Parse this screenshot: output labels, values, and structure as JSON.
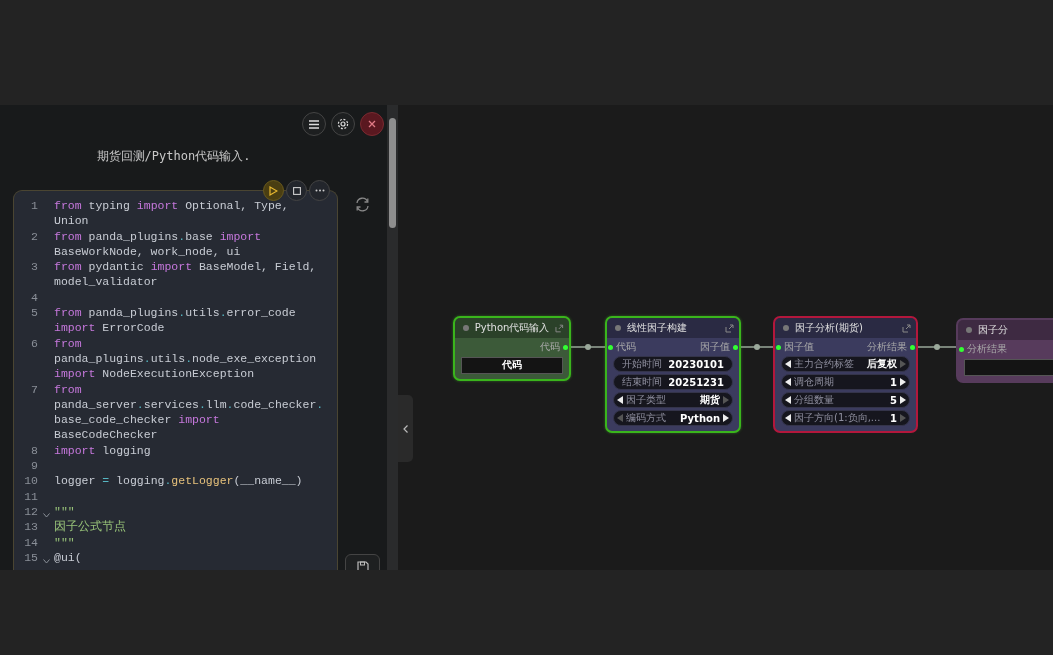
{
  "panel": {
    "title": "期货回测/Python代码输入.",
    "code_lines": [
      {
        "number": "1",
        "fold": false,
        "tokens": [
          {
            "kind": "kw",
            "text": "from"
          },
          {
            "kind": "plain",
            "text": " typing "
          },
          {
            "kind": "kw",
            "text": "import"
          },
          {
            "kind": "plain",
            "text": " Optional, Type,"
          },
          {
            "kind": "wrap"
          },
          {
            "kind": "plain",
            "text": "Union"
          }
        ]
      },
      {
        "number": "2",
        "fold": false,
        "tokens": [
          {
            "kind": "kw",
            "text": "from"
          },
          {
            "kind": "plain",
            "text": " panda_plugins"
          },
          {
            "kind": "op",
            "text": "."
          },
          {
            "kind": "plain",
            "text": "base "
          },
          {
            "kind": "kw",
            "text": "import"
          },
          {
            "kind": "wrap"
          },
          {
            "kind": "plain",
            "text": "BaseWorkNode, work_node, ui"
          }
        ]
      },
      {
        "number": "3",
        "fold": false,
        "tokens": [
          {
            "kind": "kw",
            "text": "from"
          },
          {
            "kind": "plain",
            "text": " pydantic "
          },
          {
            "kind": "kw",
            "text": "import"
          },
          {
            "kind": "plain",
            "text": " BaseModel, Field,"
          },
          {
            "kind": "wrap"
          },
          {
            "kind": "plain",
            "text": "model_validator"
          }
        ]
      },
      {
        "number": "4",
        "fold": false
      },
      {
        "number": "5",
        "fold": false,
        "tokens": [
          {
            "kind": "kw",
            "text": "from"
          },
          {
            "kind": "plain",
            "text": " panda_plugins"
          },
          {
            "kind": "op",
            "text": "."
          },
          {
            "kind": "plain",
            "text": "utils"
          },
          {
            "kind": "op",
            "text": "."
          },
          {
            "kind": "plain",
            "text": "error_code"
          },
          {
            "kind": "wrap"
          },
          {
            "kind": "kw",
            "text": "import"
          },
          {
            "kind": "plain",
            "text": " ErrorCode"
          }
        ]
      },
      {
        "number": "6",
        "fold": false,
        "tokens": [
          {
            "kind": "kw",
            "text": "from"
          },
          {
            "kind": "wrap"
          },
          {
            "kind": "plain",
            "text": "panda_plugins"
          },
          {
            "kind": "op",
            "text": "."
          },
          {
            "kind": "plain",
            "text": "utils"
          },
          {
            "kind": "op",
            "text": "."
          },
          {
            "kind": "plain",
            "text": "node_exe_exception"
          },
          {
            "kind": "wrap"
          },
          {
            "kind": "kw",
            "text": "import"
          },
          {
            "kind": "plain",
            "text": " NodeExecutionException"
          }
        ]
      },
      {
        "number": "7",
        "fold": false,
        "tokens": [
          {
            "kind": "kw",
            "text": "from"
          },
          {
            "kind": "wrap"
          },
          {
            "kind": "plain",
            "text": "panda_server"
          },
          {
            "kind": "op",
            "text": "."
          },
          {
            "kind": "plain",
            "text": "services"
          },
          {
            "kind": "op",
            "text": "."
          },
          {
            "kind": "plain",
            "text": "llm"
          },
          {
            "kind": "op",
            "text": "."
          },
          {
            "kind": "plain",
            "text": "code_checker"
          },
          {
            "kind": "op",
            "text": "."
          },
          {
            "kind": "wrap"
          },
          {
            "kind": "plain",
            "text": "base_code_checker "
          },
          {
            "kind": "kw",
            "text": "import"
          },
          {
            "kind": "wrap"
          },
          {
            "kind": "plain",
            "text": "BaseCodeChecker"
          }
        ]
      },
      {
        "number": "8",
        "fold": false,
        "tokens": [
          {
            "kind": "kw",
            "text": "import"
          },
          {
            "kind": "plain",
            "text": " logging"
          }
        ]
      },
      {
        "number": "9",
        "fold": false
      },
      {
        "number": "10",
        "fold": false,
        "tokens": [
          {
            "kind": "plain",
            "text": "logger "
          },
          {
            "kind": "op",
            "text": "="
          },
          {
            "kind": "plain",
            "text": " logging"
          },
          {
            "kind": "op",
            "text": "."
          },
          {
            "kind": "fn",
            "text": "getLogger"
          },
          {
            "kind": "plain",
            "text": "(__name__)"
          }
        ]
      },
      {
        "number": "11",
        "fold": false
      },
      {
        "number": "12",
        "fold": true,
        "tokens": [
          {
            "kind": "str",
            "text": "\"\"\""
          }
        ]
      },
      {
        "number": "13",
        "fold": false,
        "tokens": [
          {
            "kind": "str",
            "text": "因子公式节点"
          }
        ]
      },
      {
        "number": "14",
        "fold": false,
        "tokens": [
          {
            "kind": "str",
            "text": "\"\"\""
          }
        ]
      },
      {
        "number": "15",
        "fold": true,
        "tokens": [
          {
            "kind": "plain",
            "text": "@ui("
          }
        ]
      }
    ]
  },
  "nodes": [
    {
      "title": "Python代码输入",
      "color": "#3c5a39",
      "selected": true,
      "error": false,
      "outputs": [
        "代码"
      ],
      "widgets": [
        {
          "kind": "text",
          "value": "代码"
        }
      ]
    },
    {
      "title": "线性因子构建",
      "color": "#3b3b5e",
      "selected": true,
      "error": false,
      "inputs": [
        "代码"
      ],
      "outputs": [
        "因子值"
      ],
      "widgets": [
        {
          "kind": "field",
          "label": "开始时间",
          "value": "20230101"
        },
        {
          "kind": "field",
          "label": "结束时间",
          "value": "20251231"
        },
        {
          "kind": "combo",
          "label": "因子类型",
          "value": "期货",
          "prev_enabled": true,
          "next_enabled": false
        },
        {
          "kind": "combo",
          "label": "编码方式",
          "value": "Python",
          "prev_enabled": false,
          "next_enabled": true
        }
      ]
    },
    {
      "title": "因子分析(期货)",
      "color": "#3b3b5e",
      "selected": false,
      "error": true,
      "inputs": [
        "因子值"
      ],
      "outputs": [
        "分析结果"
      ],
      "widgets": [
        {
          "kind": "combo",
          "label": "主力合约标签",
          "value": "后复权",
          "prev_enabled": true,
          "next_enabled": false
        },
        {
          "kind": "combo",
          "label": "调仓周期",
          "value": "1",
          "prev_enabled": true,
          "next_enabled": true
        },
        {
          "kind": "combo",
          "label": "分组数量",
          "value": "5",
          "prev_enabled": true,
          "next_enabled": true
        },
        {
          "kind": "combo",
          "label": "因子方向(1:负向,...",
          "value": "1",
          "prev_enabled": true,
          "next_enabled": false
        }
      ]
    },
    {
      "title": "因子分",
      "color": "#573b5c",
      "selected": false,
      "error": false,
      "inputs": [
        "分析结果"
      ],
      "widgets": [
        {
          "kind": "text"
        }
      ]
    }
  ]
}
